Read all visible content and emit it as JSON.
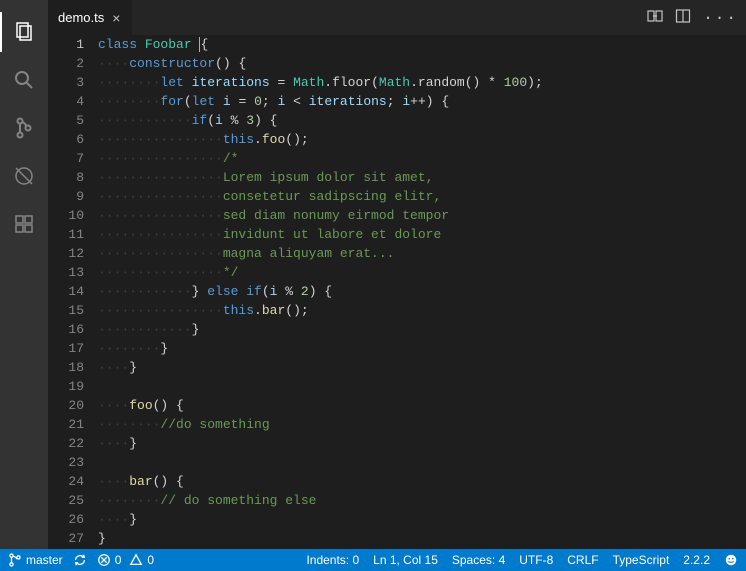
{
  "tab": {
    "filename": "demo.ts"
  },
  "code": {
    "lines": [
      [
        [
          "",
          "kw",
          "class "
        ],
        [
          "",
          "cls",
          "Foobar"
        ],
        [
          "",
          " "
        ],
        [
          "cursor",
          "brace",
          "{"
        ]
      ],
      [
        [
          "i",
          1
        ],
        [
          "",
          "kw",
          "constructor"
        ],
        [
          "",
          "brace",
          "() {"
        ]
      ],
      [
        [
          "i",
          2
        ],
        [
          "",
          "kw",
          "let "
        ],
        [
          "",
          "prop",
          "iterations"
        ],
        [
          "",
          " = "
        ],
        [
          "",
          "cls",
          "Math"
        ],
        [
          "",
          ".floor("
        ],
        [
          "",
          "cls",
          "Math"
        ],
        [
          "",
          ".random() * "
        ],
        [
          "",
          "num",
          "100"
        ],
        [
          "",
          ");"
        ]
      ],
      [
        [
          "i",
          2
        ],
        [
          "",
          "kw",
          "for"
        ],
        [
          "",
          "",
          "("
        ],
        [
          "",
          "kw",
          "let "
        ],
        [
          "",
          "prop",
          "i"
        ],
        [
          "",
          " = "
        ],
        [
          "",
          "num",
          "0"
        ],
        [
          "",
          "",
          "; "
        ],
        [
          "",
          "prop",
          "i"
        ],
        [
          "",
          " < "
        ],
        [
          "",
          "prop",
          "iterations"
        ],
        [
          "",
          "",
          "; "
        ],
        [
          "",
          "prop",
          "i"
        ],
        [
          "",
          "",
          "++) {"
        ]
      ],
      [
        [
          "i",
          3
        ],
        [
          "",
          "kw",
          "if"
        ],
        [
          "",
          "",
          "("
        ],
        [
          "",
          "prop",
          "i"
        ],
        [
          "",
          " % "
        ],
        [
          "",
          "num",
          "3"
        ],
        [
          "",
          "",
          ") {"
        ]
      ],
      [
        [
          "i",
          4
        ],
        [
          "",
          "this",
          "this"
        ],
        [
          "",
          "",
          "."
        ],
        [
          "",
          "member",
          "foo"
        ],
        [
          "",
          "",
          "();"
        ]
      ],
      [
        [
          "i",
          4
        ],
        [
          "",
          "comment",
          "/*"
        ]
      ],
      [
        [
          "i",
          4
        ],
        [
          "",
          "comment",
          "Lorem ipsum dolor sit amet,"
        ]
      ],
      [
        [
          "i",
          4
        ],
        [
          "",
          "comment",
          "consetetur sadipscing elitr,"
        ]
      ],
      [
        [
          "i",
          4
        ],
        [
          "",
          "comment",
          "sed diam nonumy eirmod tempor"
        ]
      ],
      [
        [
          "i",
          4
        ],
        [
          "",
          "comment",
          "invidunt ut labore et dolore"
        ]
      ],
      [
        [
          "i",
          4
        ],
        [
          "",
          "comment",
          "magna aliquyam erat..."
        ]
      ],
      [
        [
          "i",
          4
        ],
        [
          "",
          "comment",
          "*/"
        ]
      ],
      [
        [
          "i",
          3
        ],
        [
          "",
          "",
          "} "
        ],
        [
          "",
          "kw",
          "else if"
        ],
        [
          "",
          "",
          "("
        ],
        [
          "",
          "prop",
          "i"
        ],
        [
          "",
          " % "
        ],
        [
          "",
          "num",
          "2"
        ],
        [
          "",
          "",
          ") {"
        ]
      ],
      [
        [
          "i",
          4
        ],
        [
          "",
          "this",
          "this"
        ],
        [
          "",
          "",
          "."
        ],
        [
          "",
          "member",
          "bar"
        ],
        [
          "",
          "",
          "();"
        ]
      ],
      [
        [
          "i",
          3
        ],
        [
          "",
          "",
          "}"
        ]
      ],
      [
        [
          "i",
          2
        ],
        [
          "",
          "",
          "}"
        ]
      ],
      [
        [
          "i",
          1
        ],
        [
          "",
          "",
          "}"
        ]
      ],
      [
        [
          "",
          "",
          ""
        ]
      ],
      [
        [
          "i",
          1
        ],
        [
          "",
          "member",
          "foo"
        ],
        [
          "",
          "",
          "() {"
        ]
      ],
      [
        [
          "i",
          2
        ],
        [
          "",
          "comment",
          "//do something"
        ]
      ],
      [
        [
          "i",
          1
        ],
        [
          "",
          "",
          "}"
        ]
      ],
      [
        [
          "",
          "",
          ""
        ]
      ],
      [
        [
          "i",
          1
        ],
        [
          "",
          "member",
          "bar"
        ],
        [
          "",
          "",
          "() {"
        ]
      ],
      [
        [
          "i",
          2
        ],
        [
          "",
          "comment",
          "// do something else"
        ]
      ],
      [
        [
          "i",
          1
        ],
        [
          "",
          "",
          "}"
        ]
      ],
      [
        [
          "",
          "",
          "}"
        ]
      ]
    ]
  },
  "status": {
    "branch": "master",
    "errors": "0",
    "warnings": "0",
    "indents": "Indents: 0",
    "position": "Ln 1, Col 15",
    "spaces": "Spaces: 4",
    "encoding": "UTF-8",
    "eol": "CRLF",
    "language": "TypeScript",
    "version": "2.2.2"
  }
}
